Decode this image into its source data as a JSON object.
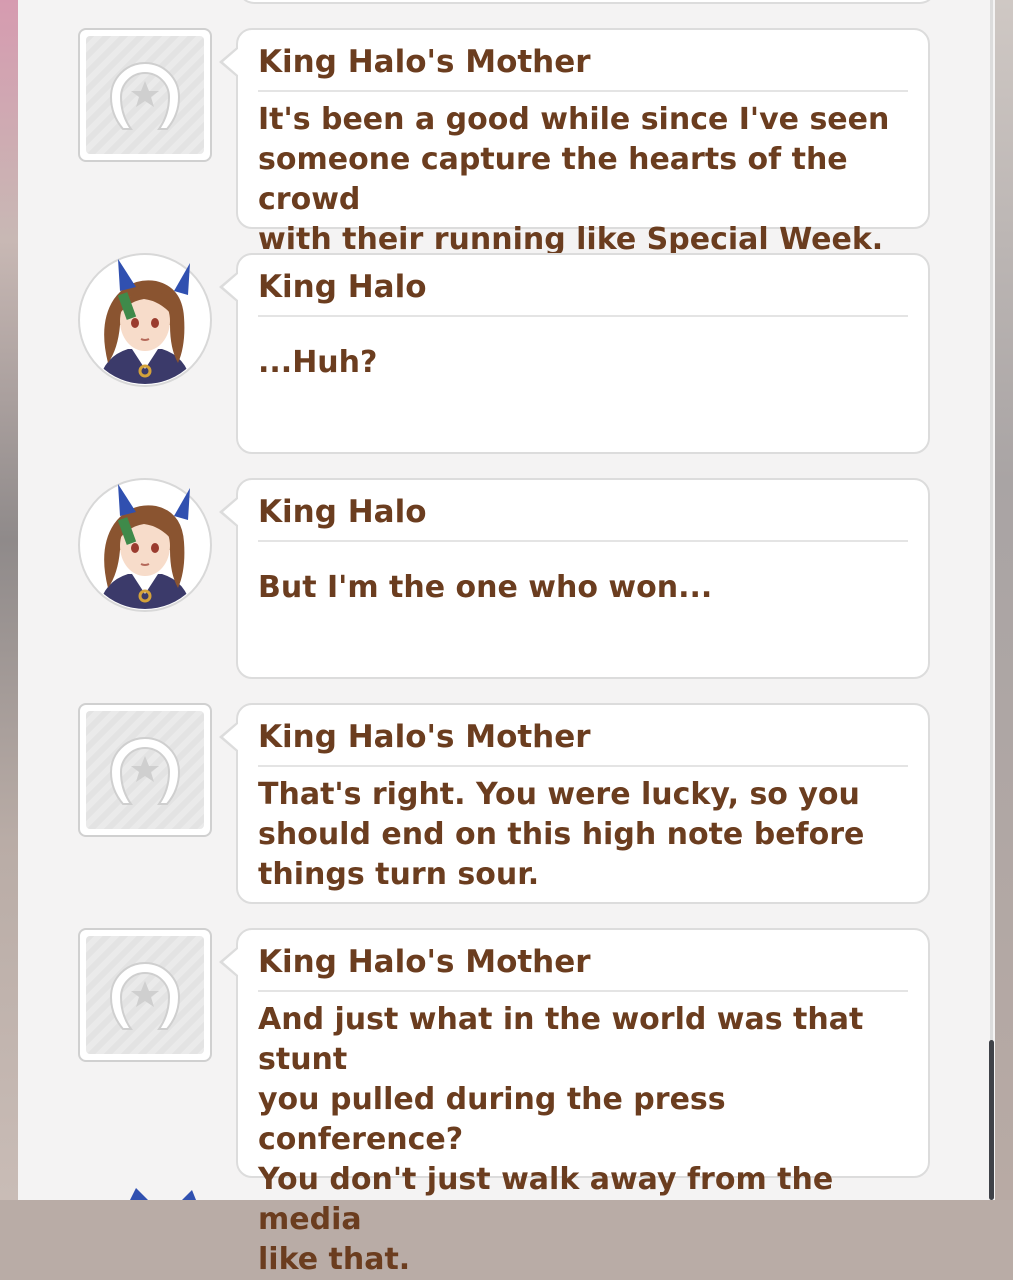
{
  "log": {
    "entries": [
      {
        "speaker": "King Halo's Mother",
        "avatar": "horseshoe-placeholder-icon",
        "lines": [
          "It's been a good while since I've seen",
          "someone capture the hearts of the crowd",
          "with their running like Special Week."
        ]
      },
      {
        "speaker": "King Halo",
        "avatar": "king-halo-portrait",
        "lines": [
          "...Huh?"
        ]
      },
      {
        "speaker": "King Halo",
        "avatar": "king-halo-portrait",
        "lines": [
          "But I'm the one who won..."
        ]
      },
      {
        "speaker": "King Halo's Mother",
        "avatar": "horseshoe-placeholder-icon",
        "lines": [
          "That's right. You were lucky, so you",
          "should end on this high note before",
          "things turn sour."
        ]
      },
      {
        "speaker": "King Halo's Mother",
        "avatar": "horseshoe-placeholder-icon",
        "lines": [
          "And just what in the world was that stunt",
          "you pulled during the press conference?",
          "You don't just walk away from the media",
          "like that."
        ]
      }
    ]
  },
  "colors": {
    "text": "#6b3d1f",
    "bubble_border": "#dcdcdc",
    "panel": "#f4f3f3"
  }
}
